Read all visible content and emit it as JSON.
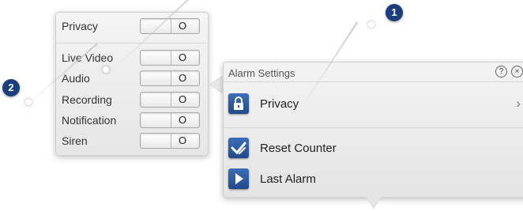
{
  "left_panel": {
    "rows": [
      {
        "label": "Privacy",
        "state": "O"
      },
      {
        "label": "Live Video",
        "state": "O"
      },
      {
        "label": "Audio",
        "state": "O"
      },
      {
        "label": "Recording",
        "state": "O"
      },
      {
        "label": "Notification",
        "state": "O"
      },
      {
        "label": "Siren",
        "state": "O"
      }
    ]
  },
  "alarm_panel": {
    "title": "Alarm Settings",
    "help_glyph": "?",
    "close_glyph": "×",
    "items": [
      {
        "label": "Privacy",
        "icon": "lock-icon",
        "has_chevron": true
      },
      {
        "label": "Reset Counter",
        "icon": "checkmark-icon",
        "has_chevron": false
      },
      {
        "label": "Last Alarm",
        "icon": "play-icon",
        "has_chevron": false
      }
    ],
    "chevron_glyph": "›"
  },
  "callouts": [
    {
      "number": "1"
    },
    {
      "number": "2"
    }
  ],
  "colors": {
    "badge": "#1b3f7d",
    "icon_blue": "#2d5ea6"
  }
}
